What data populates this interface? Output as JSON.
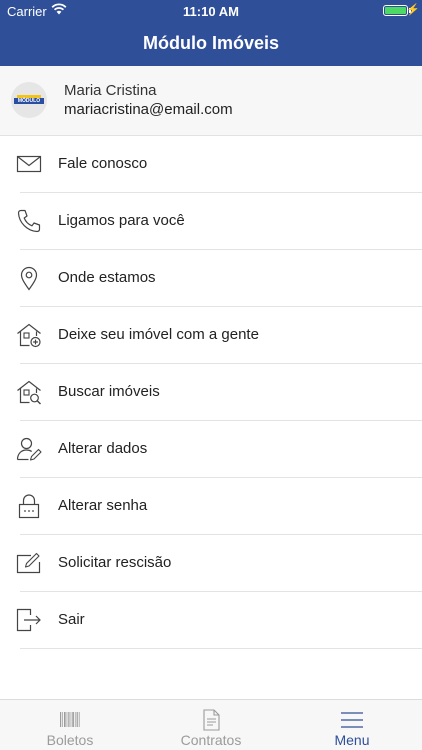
{
  "status_bar": {
    "carrier": "Carrier",
    "time": "11:10 AM",
    "battery_level": 1.0
  },
  "nav": {
    "title": "Módulo Imóveis"
  },
  "profile": {
    "avatar_text": "MÓDULO",
    "name": "Maria Cristina",
    "email": "mariacristina@email.com"
  },
  "menu": {
    "items": [
      {
        "label": "Fale conosco",
        "icon": "envelope-icon"
      },
      {
        "label": "Ligamos para você",
        "icon": "phone-icon"
      },
      {
        "label": "Onde estamos",
        "icon": "map-pin-icon"
      },
      {
        "label": "Deixe seu imóvel com a gente",
        "icon": "house-add-icon"
      },
      {
        "label": "Buscar imóveis",
        "icon": "house-search-icon"
      },
      {
        "label": "Alterar dados",
        "icon": "user-edit-icon"
      },
      {
        "label": "Alterar senha",
        "icon": "lock-icon"
      },
      {
        "label": "Solicitar rescisão",
        "icon": "edit-document-icon"
      },
      {
        "label": "Sair",
        "icon": "logout-icon"
      }
    ]
  },
  "tabbar": {
    "tabs": [
      {
        "label": "Boletos",
        "icon": "barcode-icon",
        "active": false
      },
      {
        "label": "Contratos",
        "icon": "document-icon",
        "active": false
      },
      {
        "label": "Menu",
        "icon": "hamburger-icon",
        "active": true
      }
    ]
  },
  "colors": {
    "brand": "#2f4f99",
    "tab_active": "#2f4f99",
    "tab_inactive": "#9b9b9b",
    "battery": "#4cd964"
  }
}
